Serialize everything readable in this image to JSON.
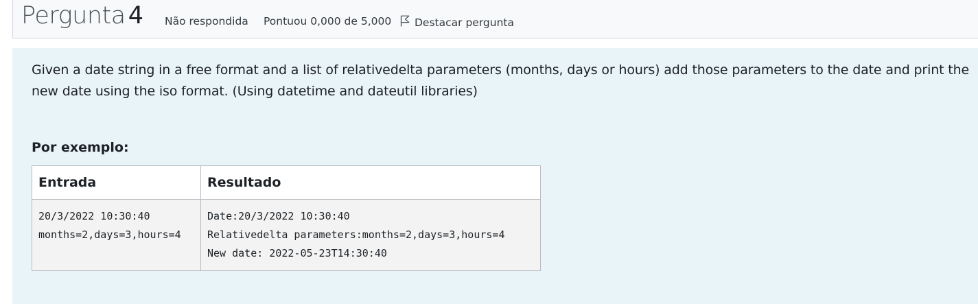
{
  "header": {
    "title_prefix": "Pergunta",
    "title_number": "4",
    "status": "Não respondida",
    "grade": "Pontuou 0,000 de 5,000",
    "flag_label": "Destacar pergunta",
    "flag_icon": "flag-outline-icon"
  },
  "question": {
    "text": "Given a date string in a free format and a list of relativedelta parameters (months, days or hours) add those parameters to the date and print the new date using the iso format. (Using datetime and dateutil libraries)",
    "example_heading": "Por exemplo:",
    "example_table": {
      "headers": [
        "Entrada",
        "Resultado"
      ],
      "rows": [
        {
          "input_lines": [
            "20/3/2022 10:30:40",
            "months=2,days=3,hours=4"
          ],
          "result_lines": [
            "Date:20/3/2022 10:30:40",
            "Relativedelta parameters:months=2,days=3,hours=4",
            "New date: 2022-05-23T14:30:40"
          ]
        }
      ]
    }
  },
  "colors": {
    "content_background": "#e8f4f8",
    "header_background": "#f8f9fa",
    "table_body_background": "#f3f3f3",
    "border": "#cfd4d9"
  }
}
